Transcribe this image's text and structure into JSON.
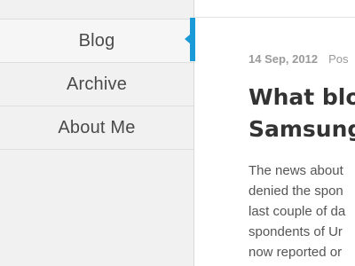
{
  "sidebar": {
    "items": [
      {
        "label": "Blog",
        "active": true
      },
      {
        "label": "Archive",
        "active": false
      },
      {
        "label": "About Me",
        "active": false
      }
    ]
  },
  "post": {
    "date": "14 Sep, 2012",
    "posted_fragment": "Pos",
    "title_lines": [
      "What blog",
      "Samsung"
    ],
    "body_lines": [
      "The news about",
      "denied the spon",
      "last couple of da",
      "spondents of Ur",
      "now reported or"
    ]
  },
  "colors": {
    "accent": "#1a9bd7",
    "sidebar_bg": "#f1f1f1",
    "title": "#333333",
    "meta": "#9a9a9a",
    "body": "#555555"
  }
}
